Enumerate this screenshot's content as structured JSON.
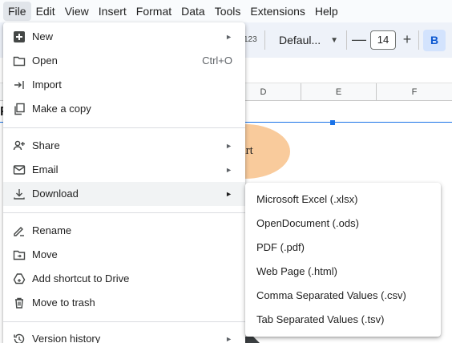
{
  "menubar": {
    "items": [
      "File",
      "Edit",
      "View",
      "Insert",
      "Format",
      "Data",
      "Tools",
      "Extensions",
      "Help"
    ]
  },
  "toolbar": {
    "number_format_label": "123",
    "font_name": "Defaul...",
    "font_size": "14",
    "decrease_symbol": "—",
    "increase_symbol": "+",
    "bold_label": "B"
  },
  "columns": [
    "D",
    "E",
    "F"
  ],
  "sheet": {
    "shape_text": "art",
    "left_letter": "F"
  },
  "file_menu": {
    "items": [
      {
        "label": "New",
        "icon": "plus-square-icon",
        "arrow": "►"
      },
      {
        "label": "Open",
        "icon": "folder-icon",
        "shortcut": "Ctrl+O"
      },
      {
        "label": "Import",
        "icon": "import-icon"
      },
      {
        "label": "Make a copy",
        "icon": "copy-icon"
      },
      {
        "label": "Share",
        "icon": "person-add-icon",
        "arrow": "►"
      },
      {
        "label": "Email",
        "icon": "email-icon",
        "arrow": "►"
      },
      {
        "label": "Download",
        "icon": "download-icon",
        "arrow": "►"
      },
      {
        "label": "Rename",
        "icon": "rename-icon"
      },
      {
        "label": "Move",
        "icon": "move-folder-icon"
      },
      {
        "label": "Add shortcut to Drive",
        "icon": "drive-shortcut-icon"
      },
      {
        "label": "Move to trash",
        "icon": "trash-icon"
      },
      {
        "label": "Version history",
        "icon": "history-icon",
        "arrow": "►"
      }
    ]
  },
  "download_submenu": {
    "items": [
      "Microsoft Excel (.xlsx)",
      "OpenDocument (.ods)",
      "PDF (.pdf)",
      "Web Page (.html)",
      "Comma Separated Values (.csv)",
      "Tab Separated Values (.tsv)"
    ]
  },
  "colors": {
    "accent": "#1a73e8",
    "shape_fill": "#f9cb9c",
    "bold_bg": "#d3e3fd"
  }
}
